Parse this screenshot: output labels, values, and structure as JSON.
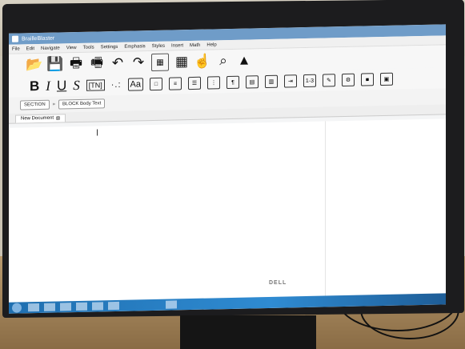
{
  "window": {
    "title": "BrailleBlaster"
  },
  "menu": [
    "File",
    "Edit",
    "Navigate",
    "View",
    "Tools",
    "Settings",
    "Emphasis",
    "Styles",
    "Insert",
    "Math",
    "Help"
  ],
  "toolbar": [
    {
      "icon": "open-folder-icon",
      "glyph": "📂"
    },
    {
      "icon": "save-icon",
      "glyph": "💾"
    },
    {
      "icon": "print-icon",
      "glyph": "🖶"
    },
    {
      "icon": "emboss-icon",
      "glyph": "🖷"
    },
    {
      "icon": "undo-icon",
      "glyph": "↶"
    },
    {
      "icon": "redo-icon",
      "glyph": "↷"
    },
    {
      "icon": "page-icon",
      "glyph": "▦"
    },
    {
      "icon": "grid-icon",
      "glyph": "▦"
    },
    {
      "icon": "touch-icon",
      "glyph": "☝"
    },
    {
      "icon": "search-icon",
      "glyph": "⌕"
    },
    {
      "icon": "image-icon",
      "glyph": "▲"
    }
  ],
  "format": {
    "bold": "B",
    "italic": "I",
    "underline": "U",
    "script": "S",
    "tn": "[TN]",
    "dots": "·.:",
    "aa": "Aa",
    "number_box": "1-3"
  },
  "stylebar": {
    "section": "SECTION",
    "separator": "»",
    "block": "BLOCK Body Text"
  },
  "tabs": {
    "document": "New Document",
    "close": "⊠"
  },
  "monitor": {
    "brand": "DELL"
  }
}
